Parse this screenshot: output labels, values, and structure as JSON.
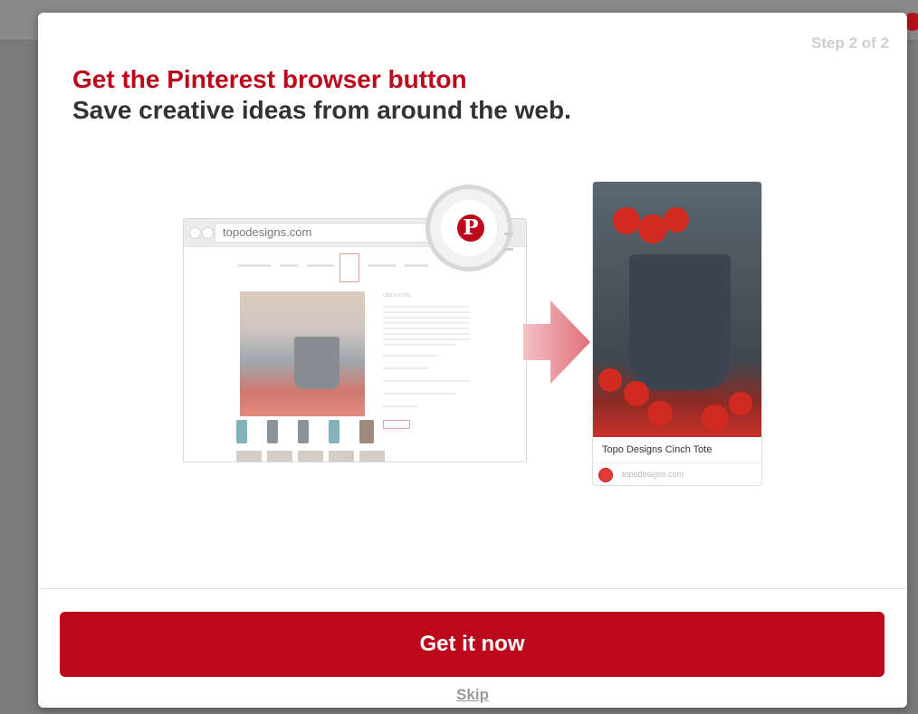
{
  "modal": {
    "step": "Step 2 of 2",
    "headline": "Get the Pinterest browser button",
    "subhead": "Save creative ideas from around the web."
  },
  "browser_mock": {
    "url": "topodesigns.com",
    "product_title": "CINCH TOTE"
  },
  "pin_button": {
    "glyph": "P",
    "brand_color": "#bd081c"
  },
  "pin_card": {
    "caption": "Topo Designs Cinch Tote",
    "source": "topodesigns.com"
  },
  "actions": {
    "primary": "Get it now",
    "skip": "Skip"
  },
  "colors": {
    "accent": "#bd081c",
    "heading": "#333333",
    "muted": "#cfcfcf"
  }
}
